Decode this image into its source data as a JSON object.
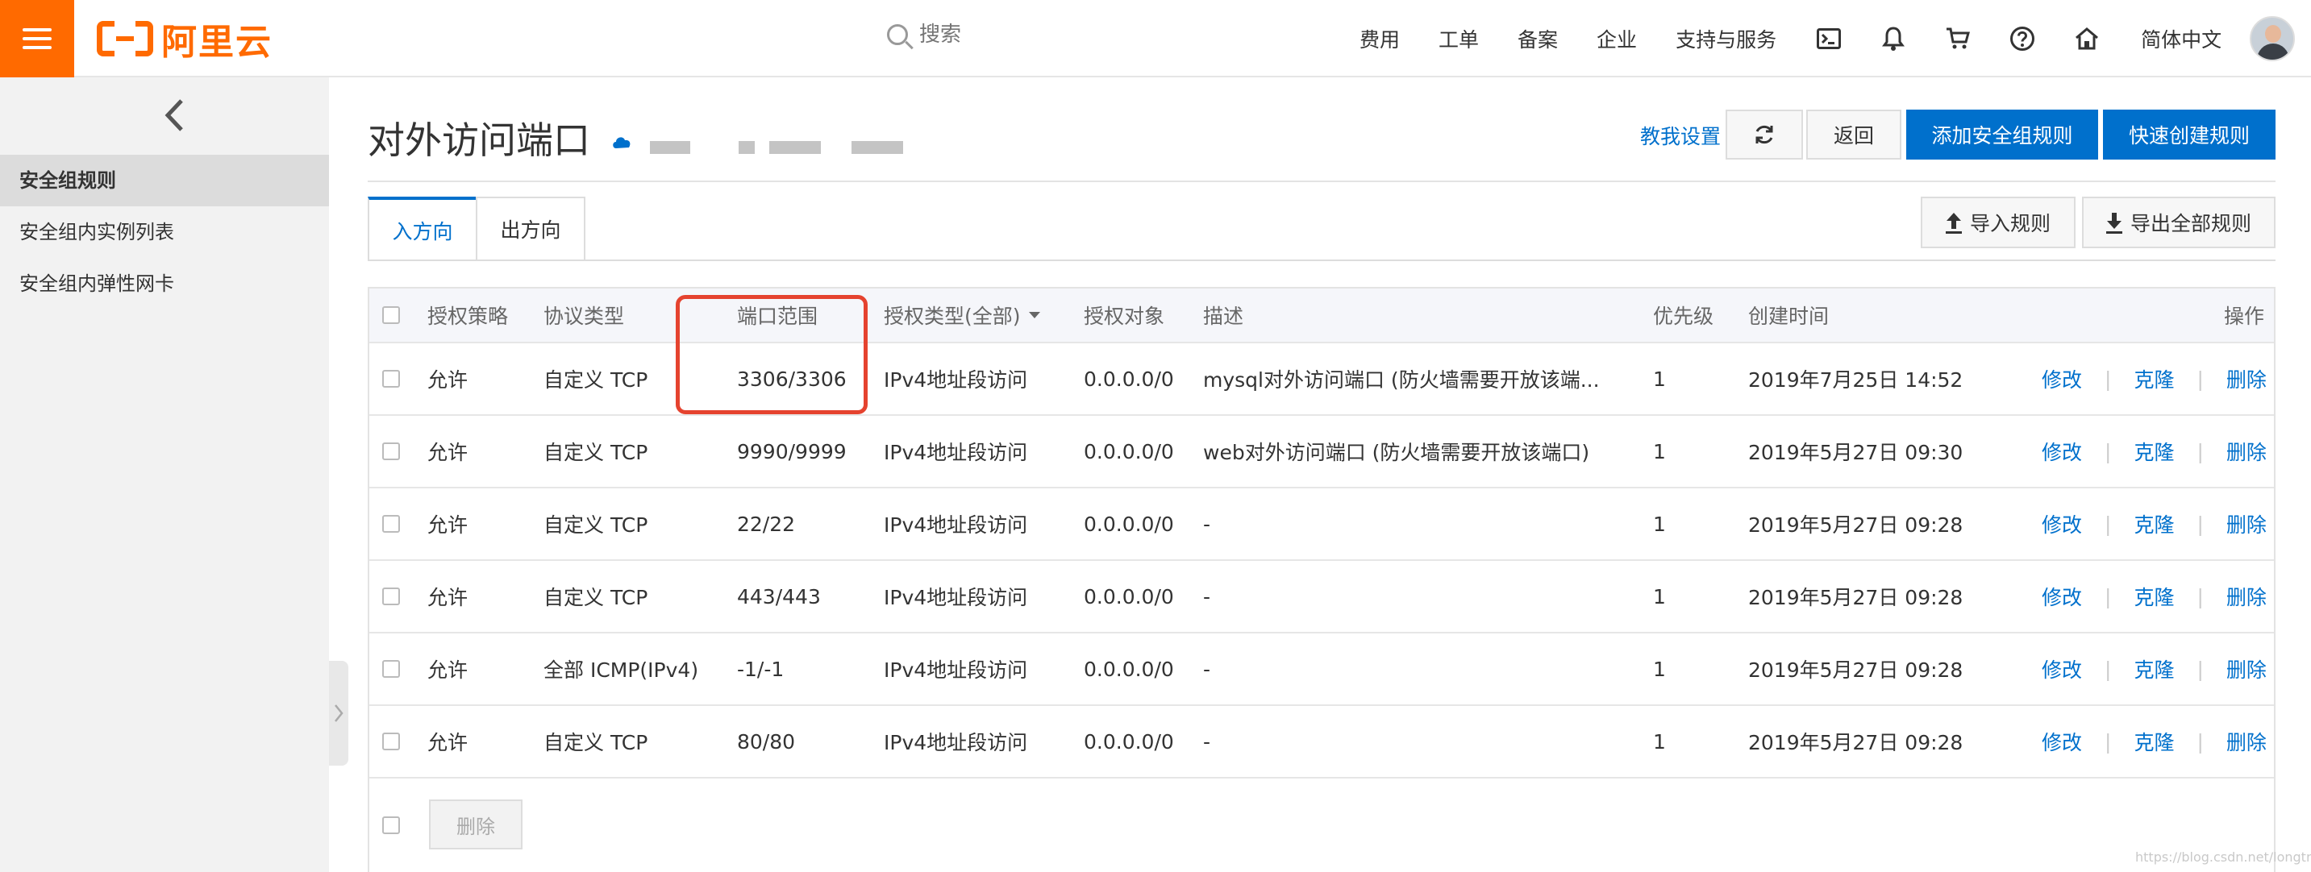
{
  "header": {
    "logo_text": "阿里云",
    "search_placeholder": "搜索",
    "nav": [
      "费用",
      "工单",
      "备案",
      "企业",
      "支持与服务"
    ],
    "lang": "简体中文",
    "icons": [
      "terminal-icon",
      "bell-icon",
      "cart-icon",
      "help-icon",
      "home-icon"
    ]
  },
  "sidebar": {
    "items": [
      {
        "label": "安全组规则",
        "active": true
      },
      {
        "label": "安全组内实例列表",
        "active": false
      },
      {
        "label": "安全组内弹性网卡",
        "active": false
      }
    ]
  },
  "page": {
    "title": "对外访问端口",
    "help_link": "教我设置",
    "back": "返回",
    "add_rule": "添加安全组规则",
    "quick_create": "快速创建规则"
  },
  "tabs": [
    {
      "label": "入方向",
      "active": true
    },
    {
      "label": "出方向",
      "active": false
    }
  ],
  "import_label": "导入规则",
  "export_label": "导出全部规则",
  "table": {
    "columns": {
      "policy": "授权策略",
      "protocol": "协议类型",
      "port": "端口范围",
      "auth_type": "授权类型(全部)",
      "target": "授权对象",
      "desc": "描述",
      "priority": "优先级",
      "created": "创建时间",
      "ops": "操作"
    },
    "op_labels": {
      "edit": "修改",
      "clone": "克隆",
      "delete": "删除"
    },
    "rows": [
      {
        "policy": "允许",
        "protocol": "自定义 TCP",
        "port": "3306/3306",
        "auth_type": "IPv4地址段访问",
        "target": "0.0.0.0/0",
        "desc": "mysql对外访问端口 (防火墙需要开放该端...",
        "priority": "1",
        "created": "2019年7月25日 14:52"
      },
      {
        "policy": "允许",
        "protocol": "自定义 TCP",
        "port": "9990/9999",
        "auth_type": "IPv4地址段访问",
        "target": "0.0.0.0/0",
        "desc": "web对外访问端口 (防火墙需要开放该端口)",
        "priority": "1",
        "created": "2019年5月27日 09:30"
      },
      {
        "policy": "允许",
        "protocol": "自定义 TCP",
        "port": "22/22",
        "auth_type": "IPv4地址段访问",
        "target": "0.0.0.0/0",
        "desc": "-",
        "priority": "1",
        "created": "2019年5月27日 09:28"
      },
      {
        "policy": "允许",
        "protocol": "自定义 TCP",
        "port": "443/443",
        "auth_type": "IPv4地址段访问",
        "target": "0.0.0.0/0",
        "desc": "-",
        "priority": "1",
        "created": "2019年5月27日 09:28"
      },
      {
        "policy": "允许",
        "protocol": "全部 ICMP(IPv4)",
        "port": "-1/-1",
        "auth_type": "IPv4地址段访问",
        "target": "0.0.0.0/0",
        "desc": "-",
        "priority": "1",
        "created": "2019年5月27日 09:28"
      },
      {
        "policy": "允许",
        "protocol": "自定义 TCP",
        "port": "80/80",
        "auth_type": "IPv4地址段访问",
        "target": "0.0.0.0/0",
        "desc": "-",
        "priority": "1",
        "created": "2019年5月27日 09:28"
      }
    ],
    "bulk_delete": "删除"
  },
  "colors": {
    "brand": "#ff6a00",
    "primary": "#0070cc",
    "highlight": "#e5432f"
  },
  "watermark": "https://blog.csdn.net/longtroul"
}
